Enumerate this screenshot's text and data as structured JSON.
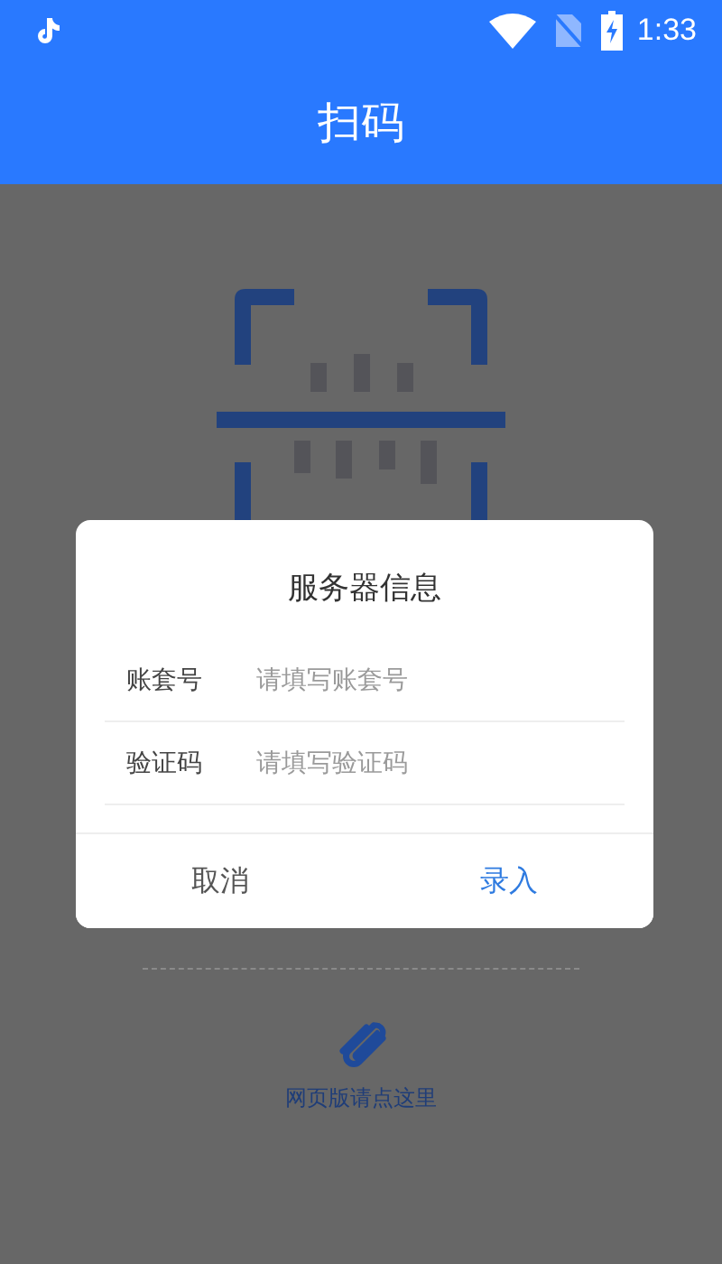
{
  "status_bar": {
    "time": "1:33"
  },
  "header": {
    "title": "扫码"
  },
  "web_link": {
    "label": "网页版请点这里"
  },
  "dialog": {
    "title": "服务器信息",
    "fields": [
      {
        "label": "账套号",
        "placeholder": "请填写账套号"
      },
      {
        "label": "验证码",
        "placeholder": "请填写验证码"
      }
    ],
    "buttons": [
      {
        "label": "取消",
        "kind": "cancel"
      },
      {
        "label": "录入",
        "kind": "confirm"
      }
    ]
  }
}
